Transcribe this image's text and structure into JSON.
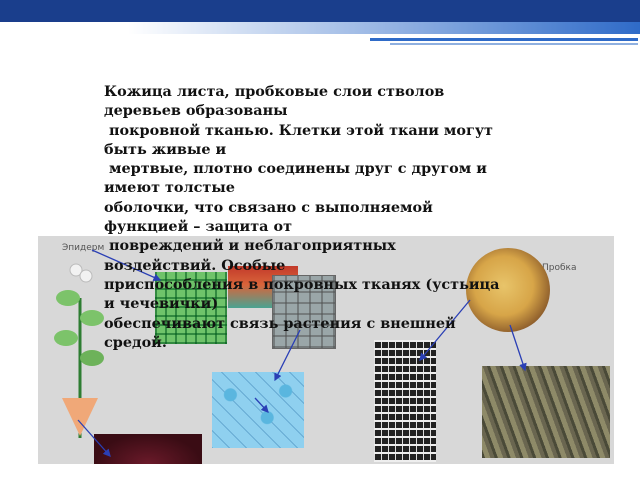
{
  "labels": {
    "epidermis": "Эпидерм",
    "cork": "Пробка"
  },
  "text_lines": [
    "Кожица листа, пробковые слои стволов",
    "деревьев образованы",
    " покровной тканью. Клетки этой ткани могут",
    "быть живые и",
    " мертвые, плотно соединены друг с другом и",
    "имеют толстые",
    "оболочки, что связано с выполняемой",
    "функцией – защита от",
    " повреждений и неблагоприятных",
    "воздействий. Особые",
    "приспособления в покровных тканях (устьица",
    "и чечевички)",
    "обеспечивают связь растения с внешней",
    "средой."
  ],
  "colors": {
    "title_band": "#1a3e8c",
    "accent_blue": "#2f6bc8",
    "panel": "#d8d8d8",
    "arrow": "#2a3fb5"
  }
}
